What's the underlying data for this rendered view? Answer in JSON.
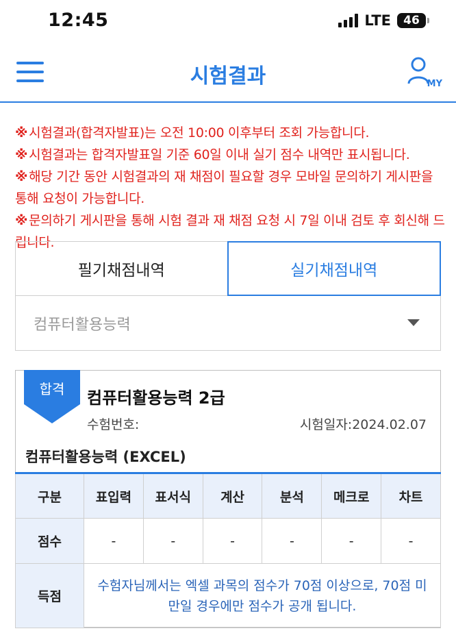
{
  "status_bar": {
    "time": "12:45",
    "network": "LTE",
    "battery": "46"
  },
  "header": {
    "title": "시험결과",
    "my_label": "MY",
    "icons": [
      "hamburger-menu-icon",
      "user-icon"
    ]
  },
  "notices": [
    {
      "mark": "※",
      "text": "시험결과(합격자발표)는 오전 10:00 이후부터 조회 가능합니다."
    },
    {
      "mark": "※",
      "text": "시험결과는 합격자발표일 기준 60일 이내 실기 점수 내역만 표시됩니다."
    },
    {
      "mark": "※",
      "text": "해당 기간 동안 시험결과의 재 채점이 필요할 경우 모바일 문의하기 게시판을 통해 요청이 가능합니다."
    },
    {
      "mark": "※",
      "text": "문의하기 게시판을 통해 시험 결과 재 채점 요청 시 7일 이내 검토 후 회신해 드립니다."
    }
  ],
  "tabs": [
    {
      "label": "필기채점내역",
      "active": false
    },
    {
      "label": "실기채점내역",
      "active": true
    }
  ],
  "select": {
    "value": "컴퓨터활용능력"
  },
  "result": {
    "badge": "합격",
    "title": "컴퓨터활용능력 2급",
    "exam_no_label": "수험번호:",
    "exam_date": "시험일자:2024.02.07",
    "subject": "컴퓨터활용능력 (EXCEL)",
    "table": {
      "headers": [
        "구분",
        "표입력",
        "표서식",
        "계산",
        "분석",
        "메크로",
        "차트"
      ],
      "score_label": "점수",
      "scores": [
        "-",
        "-",
        "-",
        "-",
        "-",
        "-"
      ],
      "gain_label": "득점",
      "gain_message": "수험자님께서는 엑셀 과목의 점수가 70점 이상으로, 70점 미만일 경우에만 점수가 공개 됩니다."
    }
  },
  "colors": {
    "accent": "#2a7de1",
    "notice": "#e0221d",
    "message": "#2a64b8",
    "table_header_bg": "#e9f0fb"
  }
}
